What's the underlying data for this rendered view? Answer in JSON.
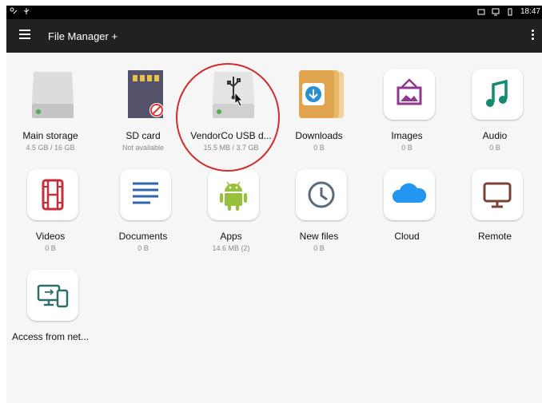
{
  "status_bar": {
    "time": "18:47"
  },
  "appbar": {
    "title": "File Manager +"
  },
  "tiles": [
    {
      "label": "Main storage",
      "sub": "4.5 GB / 16 GB",
      "icon": "hard-drive-icon"
    },
    {
      "label": "SD card",
      "sub": "Not available",
      "icon": "sd-card-icon"
    },
    {
      "label": "VendorCo USB d...",
      "sub": "15.5 MB / 3.7 GB",
      "icon": "usb-drive-icon"
    },
    {
      "label": "Downloads",
      "sub": "0 B",
      "icon": "downloads-icon"
    },
    {
      "label": "Images",
      "sub": "0 B",
      "icon": "images-icon"
    },
    {
      "label": "Audio",
      "sub": "0 B",
      "icon": "audio-icon"
    },
    {
      "label": "Videos",
      "sub": "0 B",
      "icon": "videos-icon"
    },
    {
      "label": "Documents",
      "sub": "0 B",
      "icon": "documents-icon"
    },
    {
      "label": "Apps",
      "sub": "14.6 MB (2)",
      "icon": "android-icon"
    },
    {
      "label": "New files",
      "sub": "0 B",
      "icon": "clock-icon"
    },
    {
      "label": "Cloud",
      "sub": "",
      "icon": "cloud-icon"
    },
    {
      "label": "Remote",
      "sub": "",
      "icon": "monitor-icon"
    },
    {
      "label": "Access from net...",
      "sub": "",
      "icon": "network-devices-icon"
    }
  ],
  "colors": {
    "appbar": "#212121",
    "downloads": "#e0a44e",
    "images": "#8e3a8f",
    "audio": "#138a72",
    "videos": "#c62f3a",
    "documents": "#3164ae",
    "apps": "#97c03d",
    "new_files": "#5c6b7a",
    "cloud": "#2196f3",
    "remote": "#7a4236",
    "network": "#2c6f6b",
    "highlight_circle": "#d12b2b"
  }
}
